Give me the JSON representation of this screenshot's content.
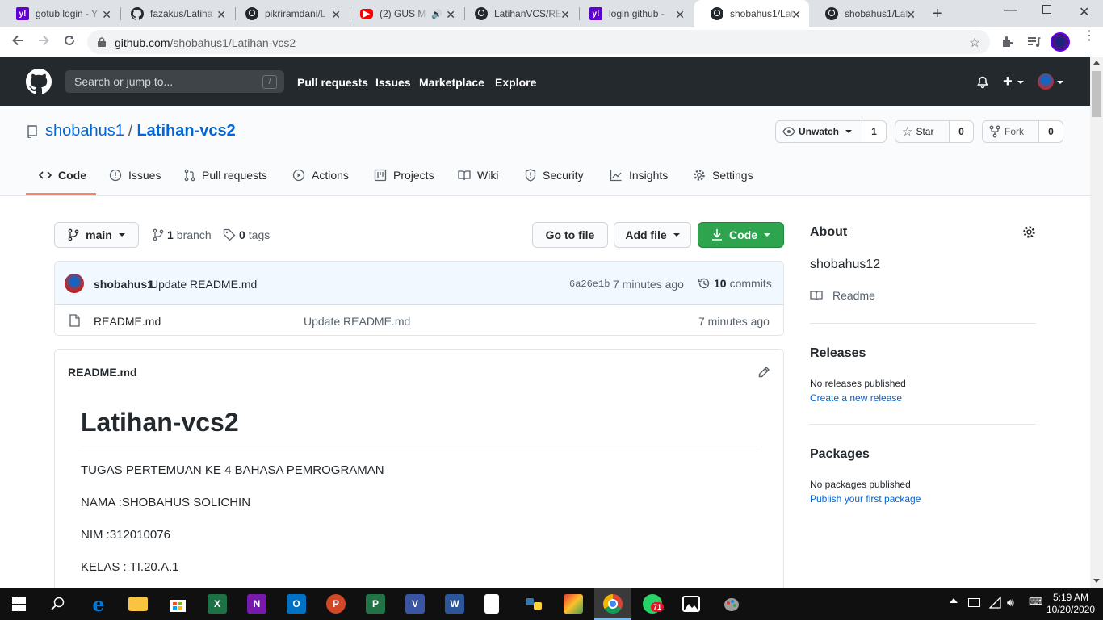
{
  "browser": {
    "tabs": [
      {
        "label": "gotub login - Y",
        "icon": "yahoo-icon"
      },
      {
        "label": "fazakus/Latiha",
        "icon": "github-icon"
      },
      {
        "label": "pikriramdani/L",
        "icon": "github-icon"
      },
      {
        "label": "(2) GUS M",
        "icon": "youtube-icon"
      },
      {
        "label": "LatihanVCS/RE",
        "icon": "github-icon"
      },
      {
        "label": "login github - ",
        "icon": "yahoo-icon"
      },
      {
        "label": "shobahus1/Lat",
        "icon": "github-icon"
      },
      {
        "label": "shobahus1/Lat",
        "icon": "github-icon"
      }
    ],
    "url_host": "github.com",
    "url_path": "/shobahus1/Latihan-vcs2"
  },
  "gh_header": {
    "search_placeholder": "Search or jump to...",
    "search_shortcut": "/",
    "nav": [
      "Pull requests",
      "Issues",
      "Marketplace",
      "Explore"
    ]
  },
  "repo": {
    "owner": "shobahus1",
    "separator": "/",
    "name": "Latihan-vcs2",
    "unwatch_label": "Unwatch",
    "watch_count": "1",
    "star_label": "Star",
    "star_count": "0",
    "fork_label": "Fork",
    "fork_count": "0",
    "tabs": [
      "Code",
      "Issues",
      "Pull requests",
      "Actions",
      "Projects",
      "Wiki",
      "Security",
      "Insights",
      "Settings"
    ]
  },
  "branch_bar": {
    "branch": "main",
    "branch_count": "1",
    "branch_word": "branch",
    "tag_count": "0",
    "tag_word": "tags",
    "go_to_file": "Go to file",
    "add_file": "Add file",
    "code": "Code"
  },
  "commit": {
    "author": "shobahus1",
    "message": "Update README.md",
    "sha": "6a26e1b",
    "time": "7 minutes ago",
    "commit_count": "10",
    "commit_word": "commits"
  },
  "files": [
    {
      "name": "README.md",
      "message": "Update README.md",
      "time": "7 minutes ago"
    }
  ],
  "readme": {
    "filename": "README.md",
    "title": "Latihan-vcs2",
    "lines": [
      "TUGAS PERTEMUAN KE 4 BAHASA PEMROGRAMAN",
      "NAMA :SHOBAHUS SOLICHIN",
      "NIM :312010076",
      "KELAS : TI.20.A.1"
    ]
  },
  "sidebar": {
    "about": "About",
    "description": "shobahus12",
    "readme_link": "Readme",
    "releases": "Releases",
    "no_releases": "No releases published",
    "create_release": "Create a new release",
    "packages": "Packages",
    "no_packages": "No packages published",
    "publish_package": "Publish your first package"
  },
  "taskbar": {
    "time": "5:19 AM",
    "date": "10/20/2020",
    "whatsapp_badge": "71"
  },
  "colors": {
    "gh_header": "#24292e",
    "link": "#0366d6",
    "green_button": "#2ea44f",
    "tab_underline": "#f9826c"
  }
}
